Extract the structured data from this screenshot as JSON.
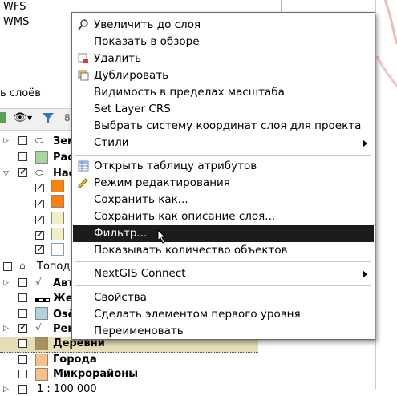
{
  "top_list": [
    "WFS",
    "WMS"
  ],
  "panel": {
    "title": "ь слоёв",
    "scale": "1 : 100 000"
  },
  "layers": {
    "zem": "Зем",
    "ras": "Рас",
    "nas": "Нас",
    "topo": "Топод",
    "avt": "Авт",
    "zhe": "Же",
    "oze": "Озё",
    "rek": "Рек",
    "derevni": "Деревни",
    "goroda": "Города",
    "mikro": "Микрорайоны"
  },
  "colors": {
    "orange": "#f7820f",
    "light_yellow": "#f2efc4",
    "light_blue": "#aed3d9",
    "light_green": "#a8d49f",
    "derevni_swatch": "#a98f5d",
    "goroda_swatch": "#f6c08b",
    "mikro_swatch": "#f6c08b",
    "selected_row": "#e6dcb6"
  },
  "menu": {
    "zoom_to_layer": "Увеличить до слоя",
    "show_in_overview": "Показать в обзоре",
    "remove": "Удалить",
    "duplicate": "Дублировать",
    "scale_visibility": "Видимость в пределах масштаба",
    "set_layer_crs": "Set Layer CRS",
    "set_project_crs": "Выбрать систему координат слоя для проекта",
    "styles": "Стили",
    "open_attribute_table": "Открыть таблицу атрибутов",
    "toggle_editing": "Режим редактирования",
    "save_as": "Сохранить как...",
    "save_as_layer_definition": "Сохранить как описание слоя...",
    "filter": "Фильтр...",
    "show_feature_count": "Показывать количество объектов",
    "nextgis_connect": "NextGIS Connect",
    "properties": "Свойства",
    "make_top_level": "Сделать элементом первого уровня",
    "rename": "Переименовать"
  }
}
